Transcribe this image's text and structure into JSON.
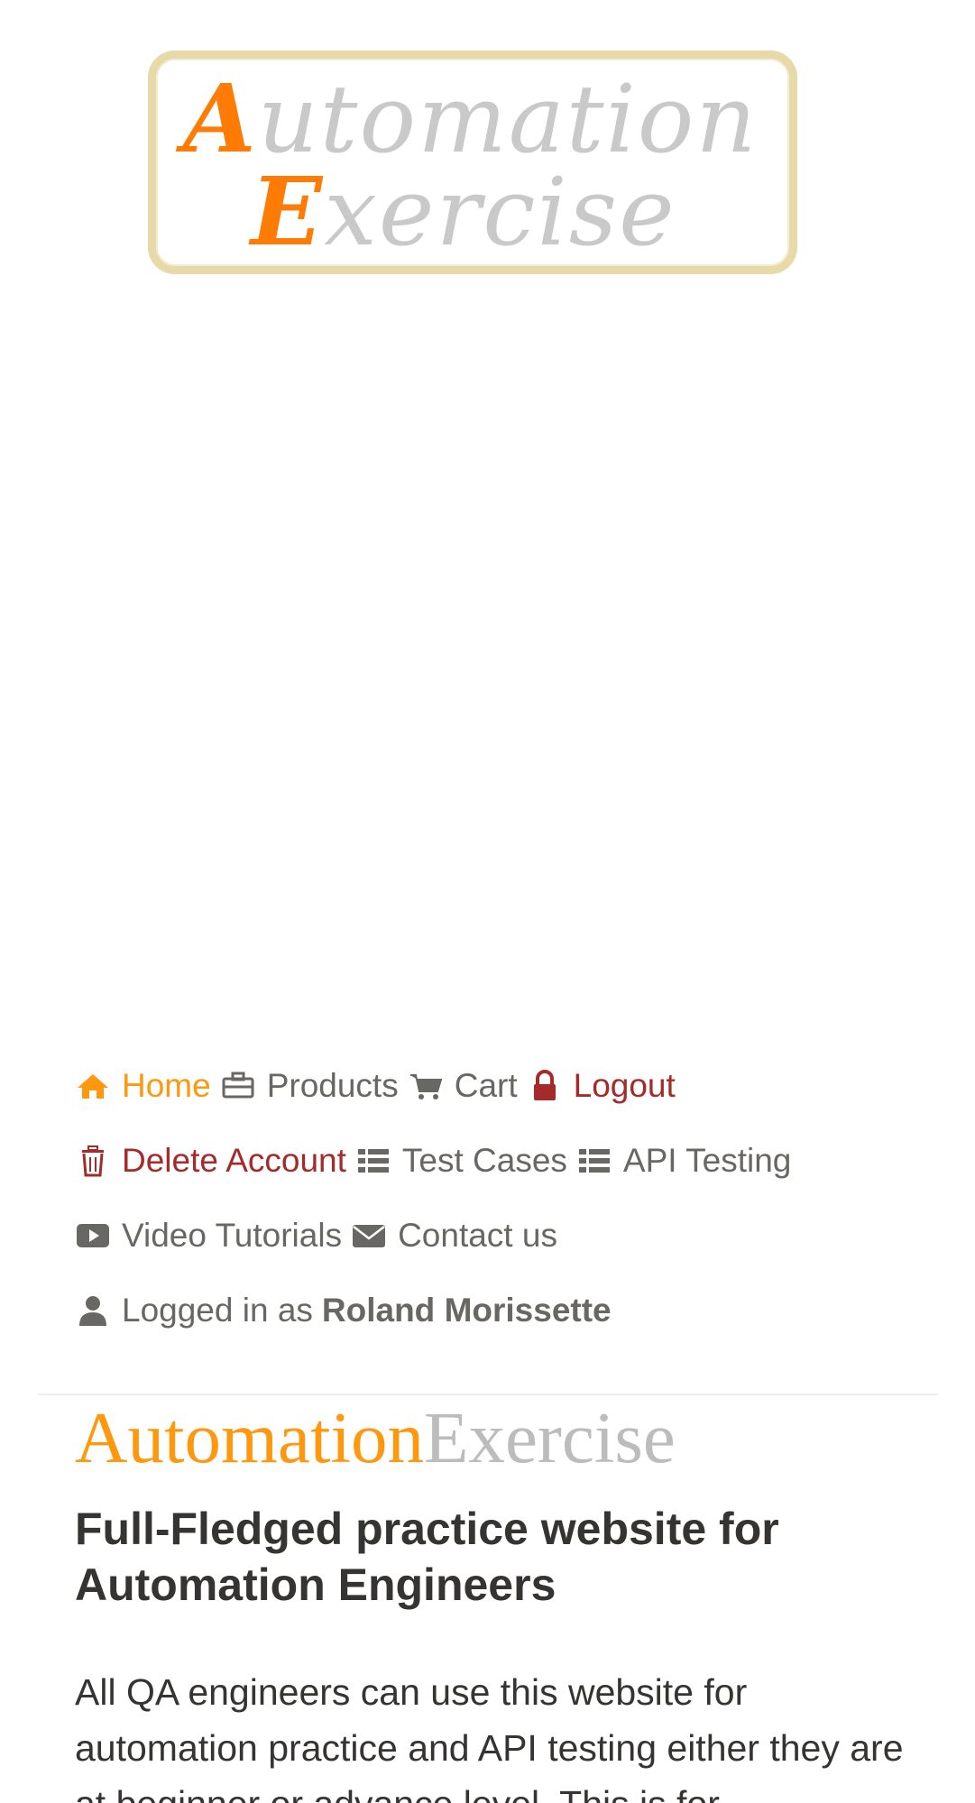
{
  "logo": {
    "line1_cap": "A",
    "line1_rest": "utomation",
    "line2_cap": "E",
    "line2_rest": "xercise"
  },
  "nav": {
    "home": "Home",
    "products": "Products",
    "cart": "Cart",
    "logout": "Logout",
    "delete_account": "Delete Account",
    "test_cases": "Test Cases",
    "api_testing": "API Testing",
    "video_tutorials": "Video Tutorials",
    "contact_us": "Contact us",
    "logged_in_prefix": "Logged in as",
    "username": "Roland Morissette"
  },
  "hero": {
    "brand_part1": "Automation",
    "brand_part2": "Exercise",
    "heading": "Full-Fledged practice website for Automation Engineers",
    "description": "All QA engineers can use this website for automation practice and API testing either they are at beginner or advance level. This is for"
  },
  "colors": {
    "accent": "#fe980f",
    "danger": "#a52a2a",
    "text": "#696763",
    "heading": "#363432"
  },
  "icons": {
    "home": "home-icon",
    "products": "briefcase-icon",
    "cart": "cart-icon",
    "logout": "lock-icon",
    "delete_account": "trash-icon",
    "test_cases": "list-icon",
    "api_testing": "list-icon",
    "video_tutorials": "play-icon",
    "contact_us": "envelope-icon",
    "user": "user-icon"
  }
}
